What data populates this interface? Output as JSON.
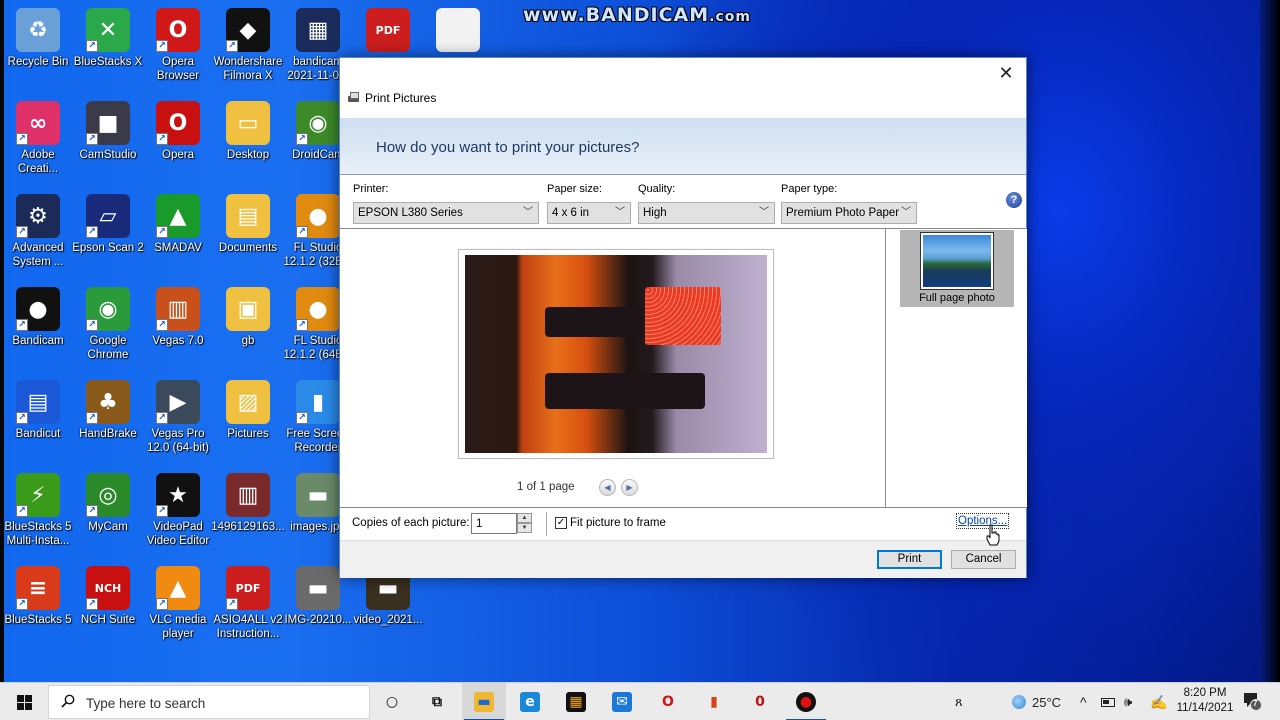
{
  "watermark": {
    "main": "www.BANDICAM",
    "suffix": ".com"
  },
  "desktop": {
    "icons": [
      {
        "label": "Recycle Bin",
        "glyph": "♻",
        "color": "#6aa0d8",
        "shortcut": false
      },
      {
        "label": "BlueStacks X",
        "glyph": "✕",
        "color": "#2aa84a",
        "shortcut": true
      },
      {
        "label": "Opera\nBrowser",
        "glyph": "O",
        "color": "#d01818",
        "shortcut": true
      },
      {
        "label": "Wondershare\nFilmora X",
        "glyph": "◆",
        "color": "#111111",
        "shortcut": true
      },
      {
        "label": "bandicam\n2021-11-0...",
        "glyph": "▦",
        "color": "#1a2a5a",
        "shortcut": false
      },
      {
        "label": "",
        "glyph": "PDF",
        "color": "#cc1e1e",
        "shortcut": false
      },
      {
        "label": "",
        "glyph": "",
        "color": "#f2f2f2",
        "shortcut": false
      },
      {
        "label": "Adobe\nCreati...",
        "glyph": "∞",
        "color": "#e0306a",
        "shortcut": true
      },
      {
        "label": "CamStudio",
        "glyph": "■",
        "color": "#3a3a48",
        "shortcut": true
      },
      {
        "label": "Opera",
        "glyph": "O",
        "color": "#c81010",
        "shortcut": true
      },
      {
        "label": "Desktop",
        "glyph": "▭",
        "color": "#f0c040",
        "shortcut": false
      },
      {
        "label": "DroidCam",
        "glyph": "◉",
        "color": "#3d8a2a",
        "shortcut": true
      },
      {
        "label": "Advanced\nSystem ...",
        "glyph": "⚙",
        "color": "#1c2a58",
        "shortcut": true
      },
      {
        "label": "Epson Scan 2",
        "glyph": "▱",
        "color": "#1a2a7a",
        "shortcut": true
      },
      {
        "label": "SMADAV",
        "glyph": "▲",
        "color": "#1a9a2a",
        "shortcut": true
      },
      {
        "label": "Documents",
        "glyph": "▤",
        "color": "#f0c040",
        "shortcut": false
      },
      {
        "label": "FL Studio\n12.1.2 (32B...",
        "glyph": "●",
        "color": "#e08a10",
        "shortcut": true
      },
      {
        "label": "Bandicam",
        "glyph": "●",
        "color": "#111111",
        "shortcut": true
      },
      {
        "label": "Google\nChrome",
        "glyph": "◉",
        "color": "#2a9a3a",
        "shortcut": true
      },
      {
        "label": "Vegas 7.0",
        "glyph": "▥",
        "color": "#c8501a",
        "shortcut": true
      },
      {
        "label": "gb",
        "glyph": "▣",
        "color": "#f0c040",
        "shortcut": false
      },
      {
        "label": "FL Studio\n12.1.2 (64B...",
        "glyph": "●",
        "color": "#e08a10",
        "shortcut": true
      },
      {
        "label": "Bandicut",
        "glyph": "▤",
        "color": "#1a58d8",
        "shortcut": true
      },
      {
        "label": "HandBrake",
        "glyph": "♣",
        "color": "#8a5a1a",
        "shortcut": true
      },
      {
        "label": "Vegas Pro\n12.0 (64-bit)",
        "glyph": "▶",
        "color": "#3a4a5a",
        "shortcut": true
      },
      {
        "label": "Pictures",
        "glyph": "▨",
        "color": "#f0c040",
        "shortcut": false
      },
      {
        "label": "Free Screen\nRecorder",
        "glyph": "▮",
        "color": "#2a8ae8",
        "shortcut": true
      },
      {
        "label": "BlueStacks 5\nMulti-Insta...",
        "glyph": "⚡",
        "color": "#3a9a1a",
        "shortcut": true
      },
      {
        "label": "MyCam",
        "glyph": "◎",
        "color": "#2a8a2a",
        "shortcut": true
      },
      {
        "label": "VideoPad\nVideo Editor",
        "glyph": "★",
        "color": "#111111",
        "shortcut": true
      },
      {
        "label": "1496129163...",
        "glyph": "▥",
        "color": "#7a2a2a",
        "shortcut": false
      },
      {
        "label": "images.jpg",
        "glyph": "▬",
        "color": "#6a8a6a",
        "shortcut": false
      },
      {
        "label": "BlueStacks 5",
        "glyph": "≡",
        "color": "#d83a1a",
        "shortcut": true
      },
      {
        "label": "NCH Suite",
        "glyph": "NCH",
        "color": "#c81010",
        "shortcut": true
      },
      {
        "label": "VLC media\nplayer",
        "glyph": "▲",
        "color": "#f08a10",
        "shortcut": true
      },
      {
        "label": "ASIO4ALL v2\nInstruction...",
        "glyph": "PDF",
        "color": "#cc1e1e",
        "shortcut": true
      },
      {
        "label": "IMG-20210...",
        "glyph": "▬",
        "color": "#6a6a6a",
        "shortcut": false
      },
      {
        "label": "video_2021...",
        "glyph": "▬",
        "color": "#3a3020",
        "shortcut": false
      }
    ]
  },
  "dialog": {
    "title": "Print Pictures",
    "question": "How do you want to print your pictures?",
    "close_symbol": "✕",
    "printer": {
      "label": "Printer:",
      "value": "EPSON L380 Series"
    },
    "paper_size": {
      "label": "Paper size:",
      "value": "4 x 6 in"
    },
    "quality": {
      "label": "Quality:",
      "value": "High"
    },
    "paper_type": {
      "label": "Paper type:",
      "value": "Premium Photo Paper"
    },
    "help_symbol": "?",
    "page_indicator": "1 of 1 page",
    "layout": {
      "label": "Full page photo",
      "selected": true
    },
    "copies": {
      "label": "Copies of each picture:",
      "value": "1"
    },
    "fit_to_frame": {
      "label": "Fit picture to frame",
      "checked": true
    },
    "options_link": "Options...",
    "print_button": "Print",
    "cancel_button": "Cancel"
  },
  "taskbar": {
    "search_placeholder": "Type here to search",
    "apps": [
      {
        "name": "cortana",
        "glyph": "○",
        "color": "#ebebeb",
        "text": "#111",
        "active": false
      },
      {
        "name": "task-view",
        "glyph": "⧉",
        "color": "#ebebeb",
        "text": "#111",
        "active": false
      },
      {
        "name": "file-explorer",
        "glyph": "▬",
        "color": "#f0b830",
        "text": "#1a6ad8",
        "active": true
      },
      {
        "name": "edge",
        "glyph": "e",
        "color": "#1a88d8",
        "text": "#fff",
        "active": false
      },
      {
        "name": "microsoft-store",
        "glyph": "▦",
        "color": "#111111",
        "text": "#f0a020",
        "active": false
      },
      {
        "name": "mail",
        "glyph": "✉",
        "color": "#1a78d8",
        "text": "#fff",
        "active": false
      },
      {
        "name": "opera",
        "glyph": "O",
        "color": "#ebebeb",
        "text": "#d01818",
        "active": false
      },
      {
        "name": "office",
        "glyph": "▮",
        "color": "#ebebeb",
        "text": "#d8401a",
        "active": false
      },
      {
        "name": "opera-gx",
        "glyph": "0",
        "color": "#ebebeb",
        "text": "#c01010",
        "active": false
      },
      {
        "name": "bandicam",
        "glyph": "●",
        "color": "#111111",
        "text": "#e01010",
        "active": true
      }
    ],
    "tray": {
      "people_symbol": "ጸ",
      "weather": "25°C",
      "chevron": "^",
      "time": "8:20 PM",
      "date": "11/14/2021",
      "notifications": "7"
    }
  }
}
